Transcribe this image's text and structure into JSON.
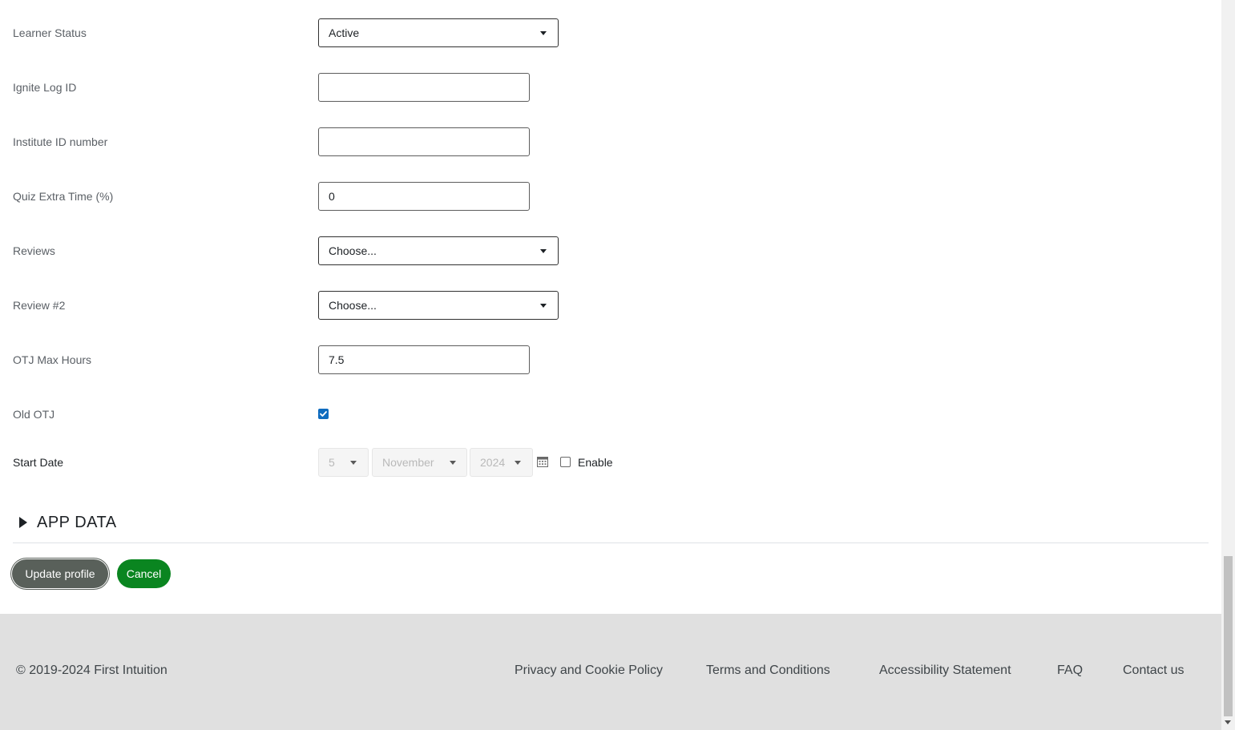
{
  "form": {
    "learner_status": {
      "label": "Learner Status",
      "value": "Active"
    },
    "ignite_log_id": {
      "label": "Ignite Log ID",
      "value": ""
    },
    "institute_id": {
      "label": "Institute ID number",
      "value": ""
    },
    "quiz_extra_time": {
      "label": "Quiz Extra Time (%)",
      "value": "0"
    },
    "reviews": {
      "label": "Reviews",
      "value": "Choose..."
    },
    "review2": {
      "label": "Review #2",
      "value": "Choose..."
    },
    "otj_max_hours": {
      "label": "OTJ Max Hours",
      "value": "7.5"
    },
    "old_otj": {
      "label": "Old OTJ",
      "checked": true
    },
    "start_date": {
      "label": "Start Date",
      "day": "5",
      "month": "November",
      "year": "2024",
      "enable_label": "Enable",
      "enabled": false
    }
  },
  "section": {
    "title": "APP DATA"
  },
  "buttons": {
    "update": "Update profile",
    "cancel": "Cancel"
  },
  "footer": {
    "copyright": "© 2019-2024 First Intuition",
    "links": [
      "Privacy and Cookie Policy",
      "Terms and Conditions",
      "Accessibility Statement",
      "FAQ",
      "Contact us"
    ]
  },
  "colors": {
    "primary_button": "#59605a",
    "cancel_button": "#0a8520",
    "checkbox": "#0f6cbf",
    "footer_bg": "#e0e0e0"
  }
}
